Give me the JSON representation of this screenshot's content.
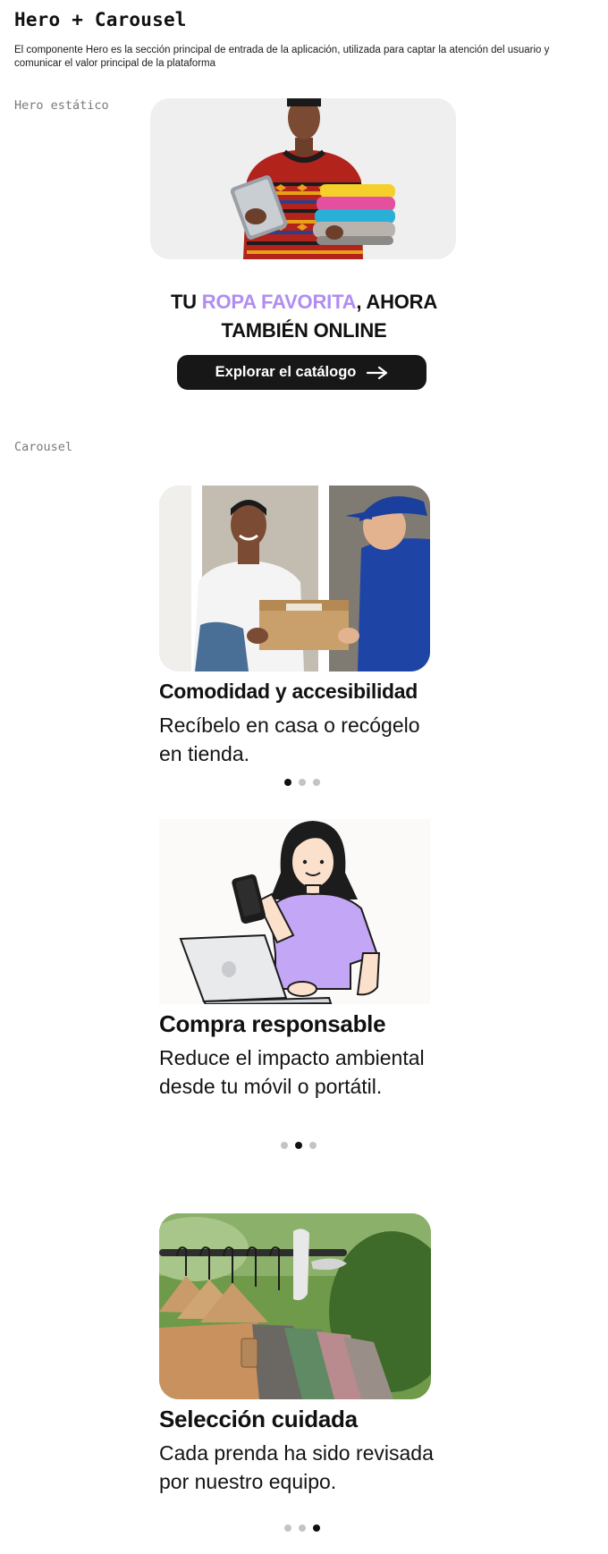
{
  "page": {
    "title": "Hero + Carousel",
    "description": "El componente Hero es la sección principal de entrada de la aplicación, utilizada para captar la atención del usuario y comunicar el valor principal de la plataforma"
  },
  "hero": {
    "section_label": "Hero estático",
    "headline_start": "TU ",
    "headline_accent": "ROPA FAVORITA",
    "headline_end": ", AHORA TAMBIÉN ONLINE",
    "cta_label": "Explorar el catálogo",
    "accent_color": "#b08ef0",
    "image": "man-holding-tablet-and-folded-clothes-photo"
  },
  "carousel": {
    "section_label": "Carousel",
    "slides": [
      {
        "title": "Comodidad y accesibilidad",
        "text": "Recíbelo en casa o recógelo en tienda.",
        "image": "courier-delivering-package-photo",
        "active_dot": 1
      },
      {
        "title": "Compra responsable",
        "text": "Reduce el impacto ambiental desde tu móvil o portátil.",
        "image": "woman-using-phone-and-laptop-illustration",
        "active_dot": 2
      },
      {
        "title": "Selección cuidada",
        "text": "Cada prenda ha sido revisada por nuestro equipo.",
        "image": "clothes-rack-with-hangers-photo",
        "active_dot": 3
      }
    ],
    "dot_count": 3
  }
}
